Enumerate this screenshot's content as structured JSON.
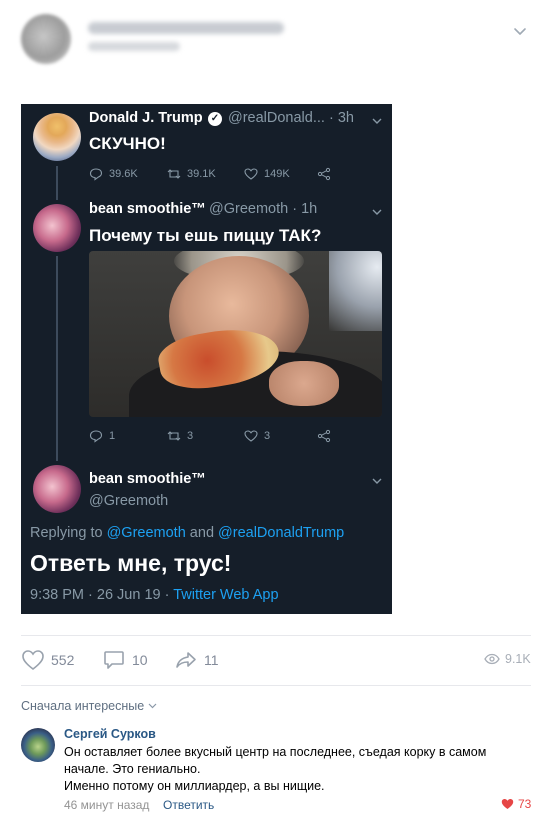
{
  "tweet": {
    "trump_name": "Donald J. Trump",
    "trump_handle": "@realDonald... · 3h",
    "trump_text": "СКУЧНО!",
    "trump_replies": "39.6K",
    "trump_retweets": "39.1K",
    "trump_likes": "149K",
    "reply1_name": "bean smoothie™",
    "reply1_handle": "@Greemoth · 1h",
    "reply1_text": "Почему ты ешь пиццу ТАК?",
    "reply1_replies": "1",
    "reply1_retweets": "3",
    "reply1_likes": "3",
    "reply2_name": "bean smoothie™",
    "reply2_handle": "@Greemoth",
    "replying_prefix": "Replying to ",
    "replying_link1": "@Greemoth",
    "replying_and": " and ",
    "replying_link2": "@realDonaldTrump",
    "reply2_text": "Ответь мне, трус!",
    "meta_time": "9:38 PM · 26 Jun 19 · ",
    "meta_app": "Twitter Web App"
  },
  "actions": {
    "likes": "552",
    "comments": "10",
    "shares": "11",
    "views": "9.1K"
  },
  "comments": {
    "sort_label": "Сначала интересные",
    "items": [
      {
        "author": "Сергей Сурков",
        "line1": "Он оставляет более вкусный центр на последнее, съедая корку в самом",
        "line2": "начале. Это гениально.",
        "line3": "Именно потому он миллиардер, а вы нищие.",
        "time": "46 минут назад",
        "reply_label": "Ответить",
        "likes": "73"
      }
    ]
  },
  "colors": {
    "vk_link": "#2a5885",
    "twitter_bg": "#151e29",
    "twitter_blue": "#1da1f2",
    "like_red": "#e64646"
  }
}
